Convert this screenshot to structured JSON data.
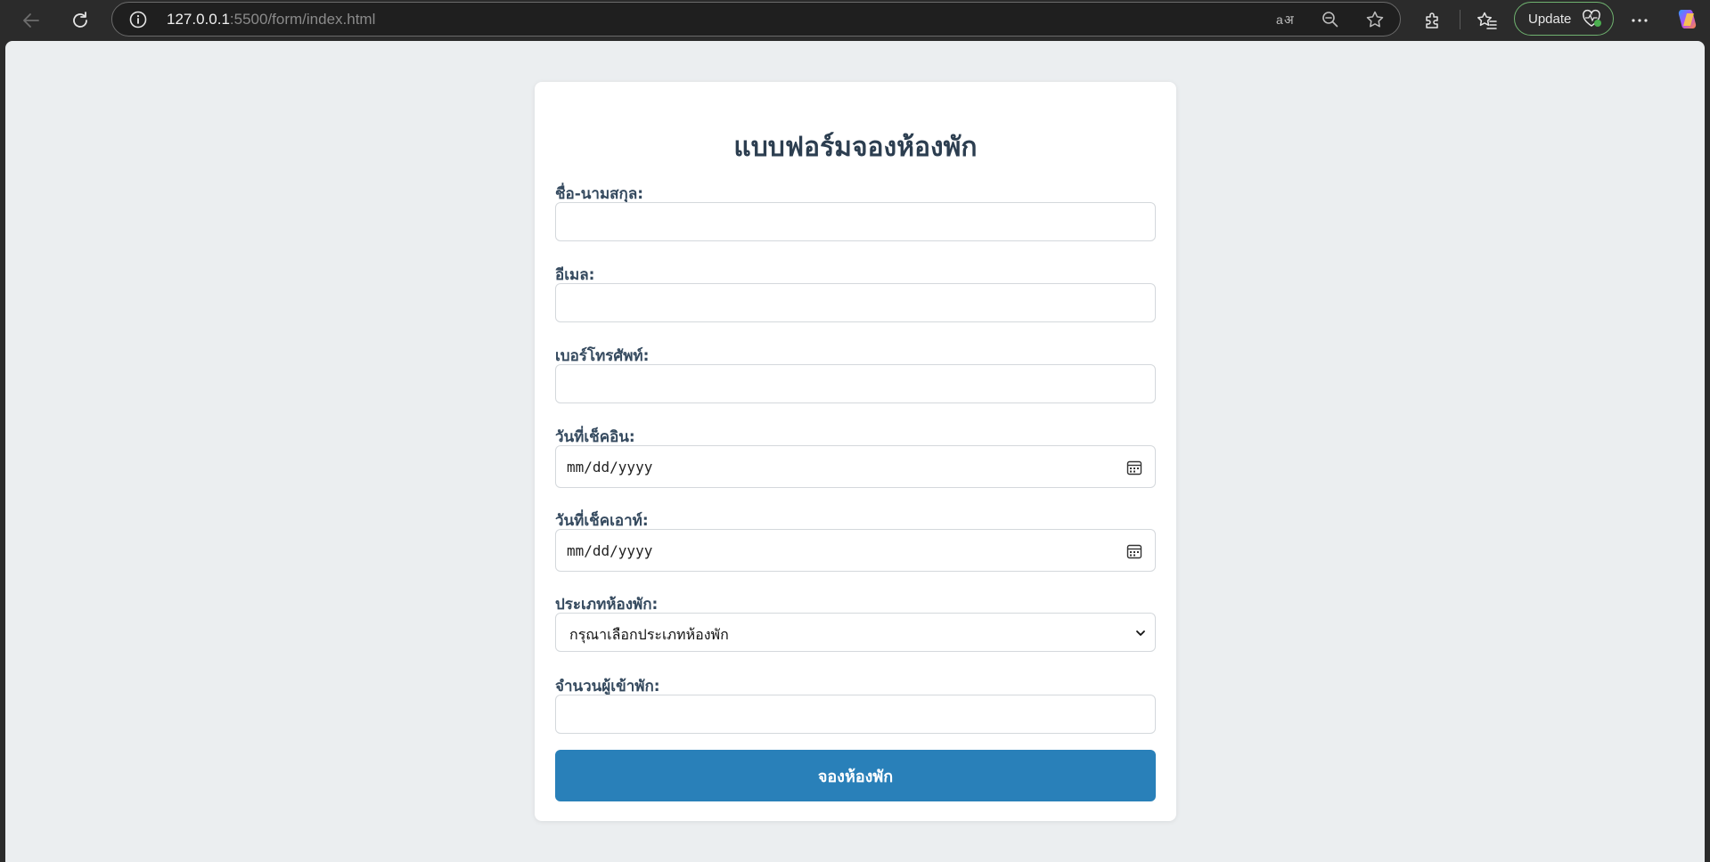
{
  "browser": {
    "url_host": "127.0.0.1",
    "url_rest": ":5500/form/index.html",
    "update_label": "Update",
    "read_aloud_icon": "translate-icon",
    "zoom_icon": "zoom-out-icon",
    "favorite_icon": "star-icon"
  },
  "form": {
    "title": "แบบฟอร์มจองห้องพัก",
    "fields": [
      {
        "label": "ชื่อ-นามสกุล:",
        "value": ""
      },
      {
        "label": "อีเมล:",
        "value": ""
      },
      {
        "label": "เบอร์โทรศัพท์:",
        "value": ""
      },
      {
        "label": "วันที่เช็คอิน:",
        "value": "mm/dd/yyyy"
      },
      {
        "label": "วันที่เช็คเอาท์:",
        "value": "mm/dd/yyyy"
      },
      {
        "label": "ประเภทห้องพัก:",
        "value": "กรุณาเลือกประเภทห้องพัก"
      },
      {
        "label": "จำนวนผู้เข้าพัก:",
        "value": ""
      }
    ],
    "submit_label": "จองห้องพัก"
  },
  "colors": {
    "page_bg": "#ebeef0",
    "title": "#2c3e50",
    "label": "#34495e",
    "button": "#2980b9"
  }
}
